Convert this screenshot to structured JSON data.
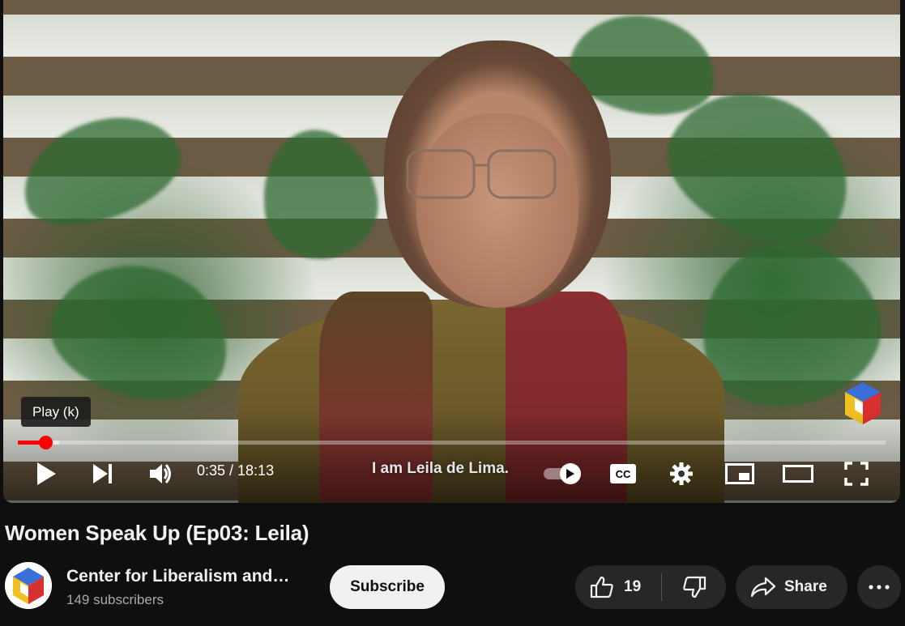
{
  "player": {
    "tooltip": "Play (k)",
    "current_time": "0:35",
    "duration": "18:13",
    "time_display": "0:35 / 18:13",
    "caption": "I am Leila de Lima.",
    "progress_played_fraction": 0.032,
    "progress_loaded_fraction": 0.048,
    "accent_color": "#ff0000",
    "controls": [
      "play-icon",
      "next-icon",
      "volume-icon",
      "autoplay-toggle",
      "cc-icon",
      "settings-icon",
      "miniplayer-icon",
      "theater-icon",
      "fullscreen-icon"
    ]
  },
  "video": {
    "title": "Women Speak Up (Ep03: Leila)"
  },
  "channel": {
    "name": "Center for Liberalism and…",
    "subscribers": "149 subscribers",
    "subscribe_label": "Subscribe"
  },
  "actions": {
    "like_count": "19",
    "share_label": "Share"
  }
}
